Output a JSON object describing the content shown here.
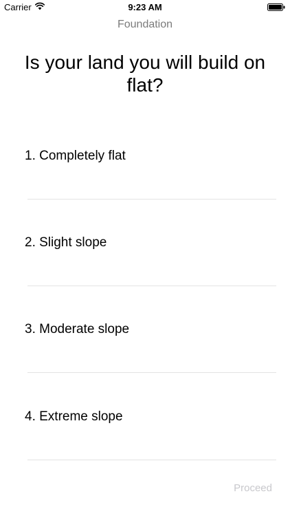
{
  "status_bar": {
    "carrier": "Carrier",
    "time": "9:23 AM"
  },
  "nav": {
    "title": "Foundation"
  },
  "question": "Is your land you will build on flat?",
  "options": [
    {
      "label": "1.  Completely flat"
    },
    {
      "label": "2.  Slight slope"
    },
    {
      "label": "3.  Moderate slope"
    },
    {
      "label": "4.  Extreme slope"
    }
  ],
  "proceed_label": "Proceed",
  "colors": {
    "nav_title": "#7b7b7b",
    "divider": "#e3e3e3",
    "proceed_disabled": "#c8c8cc"
  }
}
